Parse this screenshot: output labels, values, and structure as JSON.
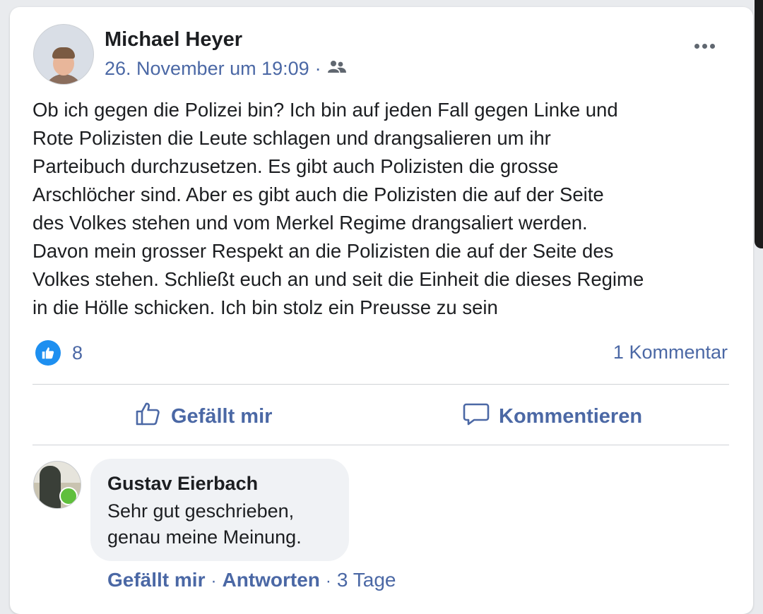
{
  "post": {
    "author": "Michael Heyer",
    "timestamp": "26. November um 19:09",
    "separator": "·",
    "audience_icon": "friends-icon",
    "more_icon": "more-options-icon",
    "text": "Ob ich gegen die Polizei bin? Ich bin auf jeden Fall gegen Linke und\nRote Polizisten die Leute schlagen und drangsalieren um ihr\nParteibuch durchzusetzen. Es gibt auch Polizisten die grosse\nArschlöcher sind. Aber es gibt auch die Polizisten die auf der Seite\ndes Volkes stehen und vom Merkel Regime drangsaliert werden.\nDavon mein grosser Respekt an die Polizisten die auf der Seite des\nVolkes stehen. Schließt euch an und seit die Einheit die dieses Regime\nin die Hölle schicken. Ich bin stolz ein Preusse zu sein",
    "like_count": "8",
    "comment_count": "1 Kommentar"
  },
  "actions": {
    "like_label": "Gefällt mir",
    "comment_label": "Kommentieren"
  },
  "comment": {
    "author": "Gustav Eierbach",
    "text": "Sehr gut geschrieben,\ngenau meine Meinung.",
    "like_label": "Gefällt mir",
    "reply_label": "Antworten",
    "separator": "·",
    "age": "3 Tage"
  },
  "colors": {
    "link_blue": "#4b68a5",
    "like_blue": "#1d8ff0",
    "text": "#1c1e21",
    "bubble": "#f0f2f5"
  }
}
